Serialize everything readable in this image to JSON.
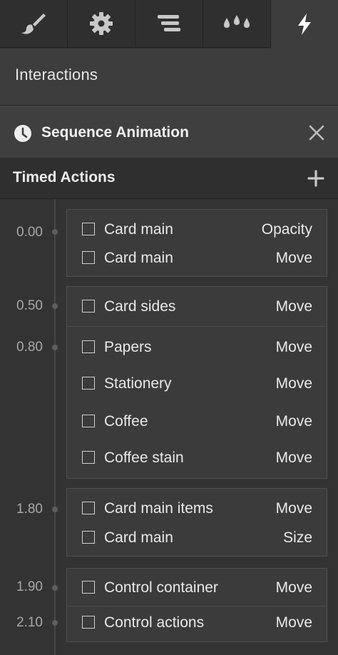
{
  "tabs": [
    {
      "icon": "brush-icon"
    },
    {
      "icon": "gear-icon"
    },
    {
      "icon": "navigator-icon"
    },
    {
      "icon": "drops-icon"
    },
    {
      "icon": "lightning-icon",
      "active": true
    }
  ],
  "interactions": {
    "label": "Interactions"
  },
  "sequence": {
    "title": "Sequence Animation",
    "icon": "clock-icon",
    "close_icon": "close-icon"
  },
  "timed_actions": {
    "title": "Timed Actions",
    "add_icon": "plus-icon"
  },
  "timeline": {
    "times": [
      "0.00",
      "0.50",
      "0.80",
      "1.80",
      "1.90",
      "2.10"
    ],
    "groups": [
      {
        "rows": [
          {
            "name": "Card main",
            "action": "Opacity"
          },
          {
            "name": "Card main",
            "action": "Move"
          }
        ]
      },
      {
        "rows": [
          {
            "name": "Card sides",
            "action": "Move"
          },
          {
            "name": "Papers",
            "action": "Move"
          },
          {
            "name": "Stationery",
            "action": "Move"
          },
          {
            "name": "Coffee",
            "action": "Move"
          },
          {
            "name": "Coffee stain",
            "action": "Move"
          }
        ]
      },
      {
        "rows": [
          {
            "name": "Card main items",
            "action": "Move"
          },
          {
            "name": "Card main",
            "action": "Size"
          }
        ]
      },
      {
        "rows": [
          {
            "name": "Control container",
            "action": "Move"
          },
          {
            "name": "Control actions",
            "action": "Move"
          }
        ]
      }
    ]
  },
  "colors": {
    "panel": "#3d3d3d",
    "tabbar": "#2e2e2e",
    "header_dark": "#2f2f2f",
    "timeline_bg": "#333333"
  }
}
